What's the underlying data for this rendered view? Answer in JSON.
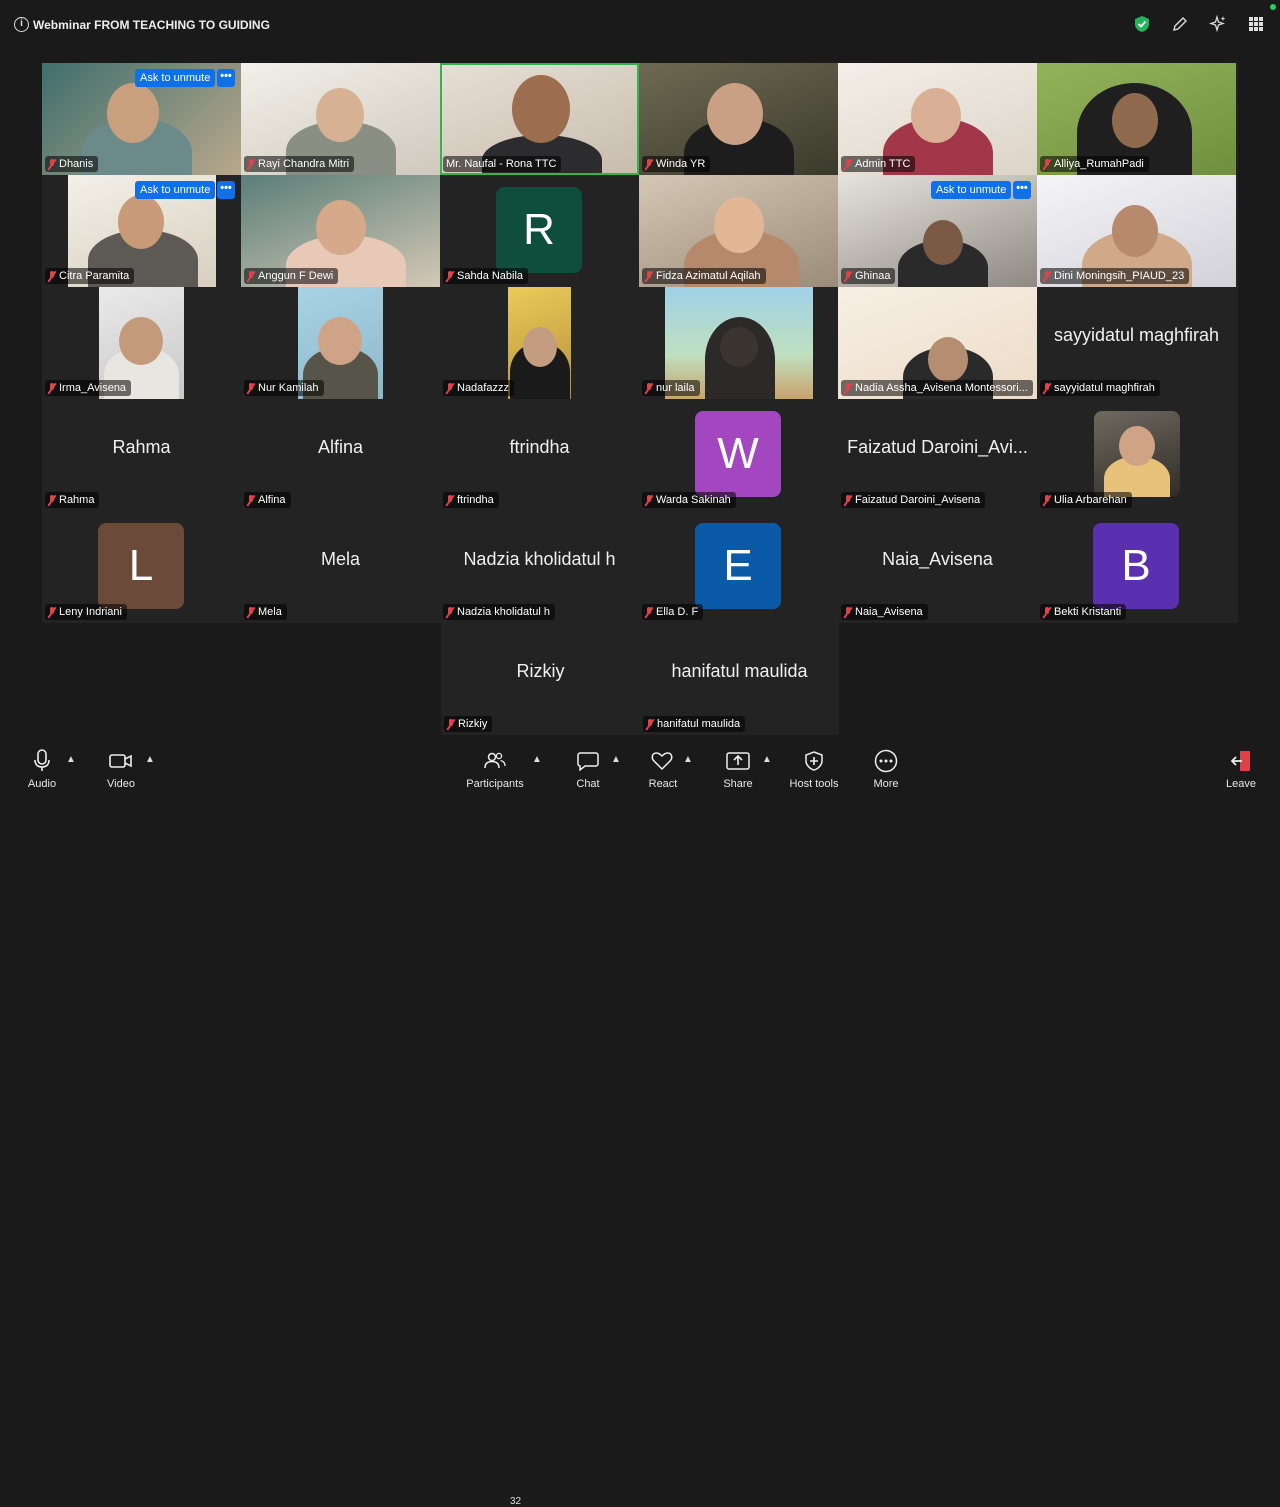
{
  "meeting": {
    "title": "Webminar FROM TEACHING TO GUIDING"
  },
  "top_icons": [
    "shield-check-icon",
    "pencil-icon",
    "sparkle-icon",
    "apps-grid-icon"
  ],
  "unmute_label": "Ask to unmute",
  "more_label": "•••",
  "participants": [
    {
      "name": "Dhanis"
    },
    {
      "name": "Rayi Chandra Mitri"
    },
    {
      "name": "Mr. Naufal - Rona TTC"
    },
    {
      "name": "Winda YR"
    },
    {
      "name": "Admin TTC"
    },
    {
      "name": "Alliya_RumahPadi"
    },
    {
      "name": "Citra Paramita"
    },
    {
      "name": "Anggun F Dewi"
    },
    {
      "name": "Sahda Nabila",
      "initial": "R"
    },
    {
      "name": "Fidza Azimatul Aqilah"
    },
    {
      "name": "Ghinaa"
    },
    {
      "name": "Dini Moningsih_PIAUD_23"
    },
    {
      "name": "Irma_Avisena"
    },
    {
      "name": "Nur Kamilah"
    },
    {
      "name": "Nadafazzz"
    },
    {
      "name": "nur laila"
    },
    {
      "name": "Nadia Assha_Avisena Montessori..."
    },
    {
      "name": "sayyidatul maghfirah",
      "display": "sayyidatul maghfirah"
    },
    {
      "name": "Rahma",
      "display": "Rahma"
    },
    {
      "name": "Alfina",
      "display": "Alfina"
    },
    {
      "name": "ftrindha",
      "display": "ftrindha"
    },
    {
      "name": "Warda Sakinah",
      "initial": "W"
    },
    {
      "name": "Faizatud Daroini_Avisena",
      "display": "Faizatud Daroini_Avi..."
    },
    {
      "name": "Ulia Arbarehan"
    },
    {
      "name": "Leny Indriani",
      "initial": "L"
    },
    {
      "name": "Mela",
      "display": "Mela"
    },
    {
      "name": "Nadzia kholidatul h",
      "display": "Nadzia kholidatul h"
    },
    {
      "name": "Ella D. F",
      "initial": "E"
    },
    {
      "name": "Naia_Avisena",
      "display": "Naia_Avisena"
    },
    {
      "name": "Bekti Kristanti",
      "initial": "B"
    },
    {
      "name": "Rizkiy",
      "display": "Rizkiy"
    },
    {
      "name": "hanifatul maulida",
      "display": "hanifatul maulida"
    }
  ],
  "avatar_colors": {
    "R": "#0f4d3c",
    "W": "#a247c0",
    "L": "#6b4a3a",
    "E": "#0b5aa8",
    "B": "#5a2fb0"
  },
  "toolbar": {
    "audio": "Audio",
    "video": "Video",
    "participants": "Participants",
    "participants_count": "32",
    "chat": "Chat",
    "react": "React",
    "share": "Share",
    "host_tools": "Host tools",
    "more": "More",
    "leave": "Leave"
  }
}
